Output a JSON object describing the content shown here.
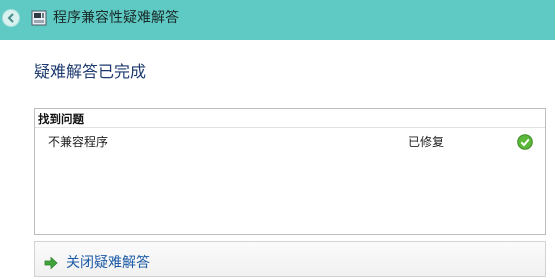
{
  "window": {
    "title": "程序兼容性疑难解答",
    "back_icon": "back-arrow-icon",
    "app_icon": "compatibility-troubleshooter-icon",
    "titlebar_color": "#5fcac4"
  },
  "main": {
    "heading": "疑难解答已完成",
    "results": {
      "header": "找到问题",
      "problems": [
        {
          "name": "不兼容程序",
          "status": "已修复",
          "status_icon": "green-check-icon",
          "status_color": "#3a9a2a"
        }
      ]
    },
    "close_action": {
      "label": "关闭疑难解答",
      "icon": "green-arrow-icon"
    }
  }
}
